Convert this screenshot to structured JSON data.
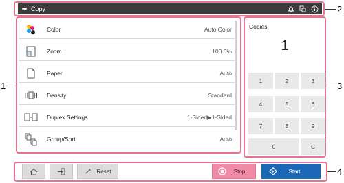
{
  "titlebar": {
    "menu_icon": "more-dots-icon",
    "title": "Copy",
    "icons": [
      "bell-icon",
      "job-status-icon",
      "info-icon"
    ]
  },
  "settings": [
    {
      "label": "Color",
      "value": "Auto Color",
      "icon": "color-drops-icon"
    },
    {
      "label": "Zoom",
      "value": "100.0%",
      "icon": "zoom-page-icon"
    },
    {
      "label": "Paper",
      "value": "Auto",
      "icon": "paper-icon"
    },
    {
      "label": "Density",
      "value": "Standard",
      "icon": "density-icon"
    },
    {
      "label": "Duplex Settings",
      "value": "1-Sided▶1-Sided",
      "icon": "duplex-icon"
    },
    {
      "label": "Group/Sort",
      "value": "Auto",
      "icon": "group-sort-icon"
    }
  ],
  "copies": {
    "label": "Copies",
    "value": "1"
  },
  "keypad": [
    "1",
    "2",
    "3",
    "4",
    "5",
    "6",
    "7",
    "8",
    "9",
    "0",
    "C"
  ],
  "bottom": {
    "home_icon": "home-icon",
    "exit_icon": "exit-icon",
    "reset_label": "Reset",
    "stop_label": "Stop",
    "start_label": "Start"
  },
  "callouts": [
    "1",
    "2",
    "3",
    "4"
  ],
  "colors": {
    "accent_frame": "#e8738f",
    "stop": "#f08aa7",
    "start": "#1b67b6",
    "titlebar": "#3c3c3c"
  }
}
